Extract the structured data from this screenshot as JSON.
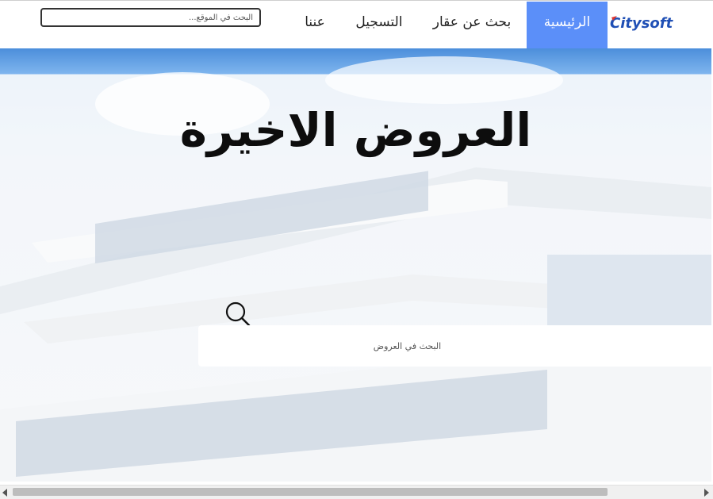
{
  "brand": {
    "logo_text": "Citysoft"
  },
  "nav": {
    "items": [
      {
        "label": "الرئيسية",
        "active": true
      },
      {
        "label": "بحث عن عقار",
        "active": false
      },
      {
        "label": "التسجيل",
        "active": false
      },
      {
        "label": "عننا",
        "active": false
      }
    ]
  },
  "site_search": {
    "placeholder": "البحث في الموقع..."
  },
  "hero": {
    "title": "العروض الاخيرة",
    "search_placeholder": "البحث في العروض"
  },
  "colors": {
    "accent": "#5b8ff9",
    "logo": "#1f4fb5",
    "logo_accent": "#e0342c"
  },
  "icons": {
    "site_search": "magnifier-icon"
  }
}
